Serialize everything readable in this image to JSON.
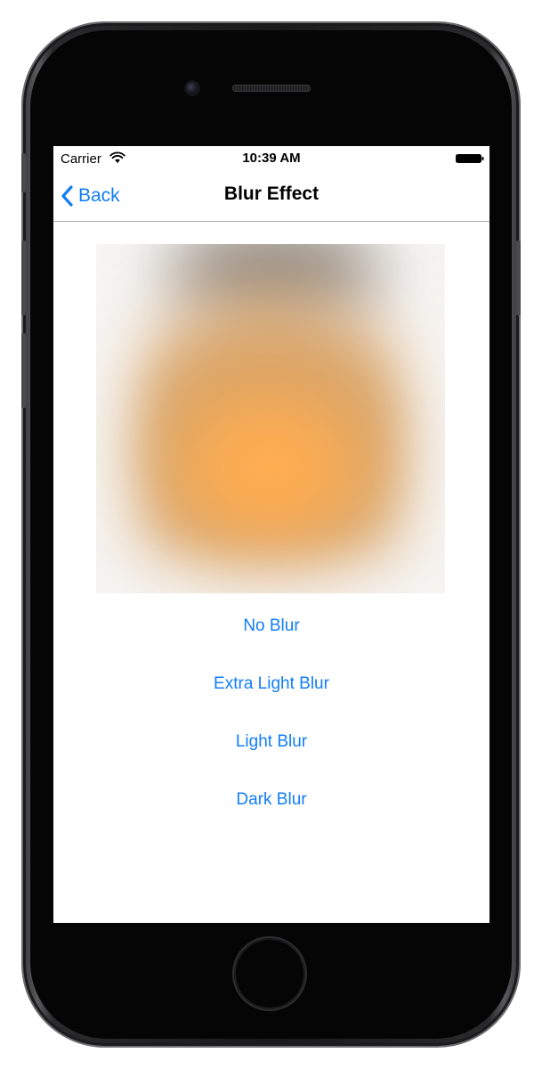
{
  "status_bar": {
    "carrier": "Carrier",
    "time": "10:39 AM",
    "wifi_icon": "wifi-icon",
    "battery_icon": "battery-full-icon"
  },
  "nav": {
    "back_label": "Back",
    "back_icon": "chevron-left-icon",
    "title": "Blur Effect"
  },
  "image": {
    "description_colors": {
      "center": "#ffad50",
      "edge": "#f5f4f2",
      "top_shadow": "#7d7570"
    }
  },
  "blur_options": [
    {
      "label": "No Blur"
    },
    {
      "label": "Extra Light Blur"
    },
    {
      "label": "Light Blur"
    },
    {
      "label": "Dark Blur"
    }
  ],
  "colors": {
    "accent": "#127ef5",
    "nav_border": "#b2b2b2"
  }
}
